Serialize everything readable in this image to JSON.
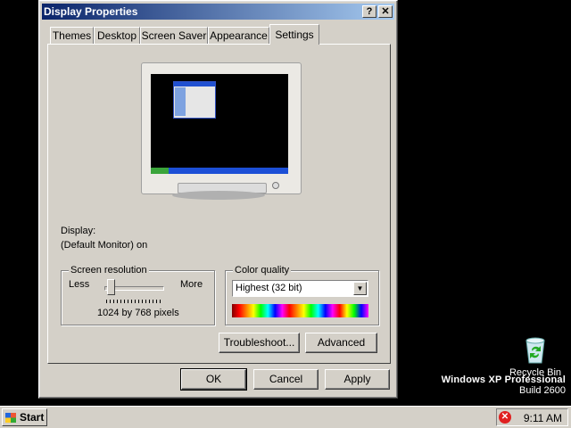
{
  "window": {
    "title": "Display Properties",
    "help_glyph": "?",
    "close_glyph": "✕"
  },
  "tabs": [
    {
      "label": "Themes"
    },
    {
      "label": "Desktop"
    },
    {
      "label": "Screen Saver"
    },
    {
      "label": "Appearance"
    },
    {
      "label": "Settings",
      "active": true
    }
  ],
  "display": {
    "label": "Display:",
    "value": "(Default Monitor) on"
  },
  "resolution": {
    "group_title": "Screen resolution",
    "less_label": "Less",
    "more_label": "More",
    "value_text": "1024 by 768 pixels",
    "slider_fraction": 0.05
  },
  "color_quality": {
    "group_title": "Color quality",
    "selected": "Highest (32 bit)"
  },
  "buttons": {
    "troubleshoot": "Troubleshoot...",
    "advanced": "Advanced",
    "ok": "OK",
    "cancel": "Cancel",
    "apply": "Apply"
  },
  "desktop": {
    "recycle_bin_label": "Recycle Bin",
    "os_name": "Windows XP Professional",
    "build": "Build 2600"
  },
  "taskbar": {
    "start_label": "Start",
    "clock": "9:11 AM"
  },
  "colors": {
    "titlebar_start": "#0a246a",
    "titlebar_end": "#a6caf0",
    "face": "#d4d0c8",
    "desktop": "#000000"
  },
  "icons": [
    "help-icon",
    "close-icon",
    "monitor-preview",
    "dropdown-arrow-icon",
    "recycle-bin-icon",
    "windows-logo-icon",
    "alert-icon"
  ]
}
